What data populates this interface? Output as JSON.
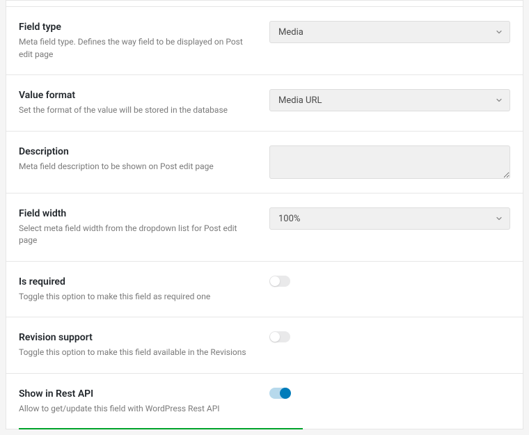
{
  "fields": {
    "field_type": {
      "title": "Field type",
      "desc": "Meta field type. Defines the way field to be displayed on Post edit page",
      "value": "Media"
    },
    "value_format": {
      "title": "Value format",
      "desc": "Set the format of the value will be stored in the database",
      "value": "Media URL"
    },
    "description": {
      "title": "Description",
      "desc": "Meta field description to be shown on Post edit page",
      "value": ""
    },
    "field_width": {
      "title": "Field width",
      "desc": "Select meta field width from the dropdown list for Post edit page",
      "value": "100%"
    },
    "is_required": {
      "title": "Is required",
      "desc": "Toggle this option to make this field as required one",
      "on": false
    },
    "revision_support": {
      "title": "Revision support",
      "desc": "Toggle this option to make this field available in the Revisions",
      "on": false
    },
    "show_in_rest": {
      "title": "Show in Rest API",
      "desc": "Allow to get/update this field with WordPress Rest API",
      "on": true
    }
  }
}
